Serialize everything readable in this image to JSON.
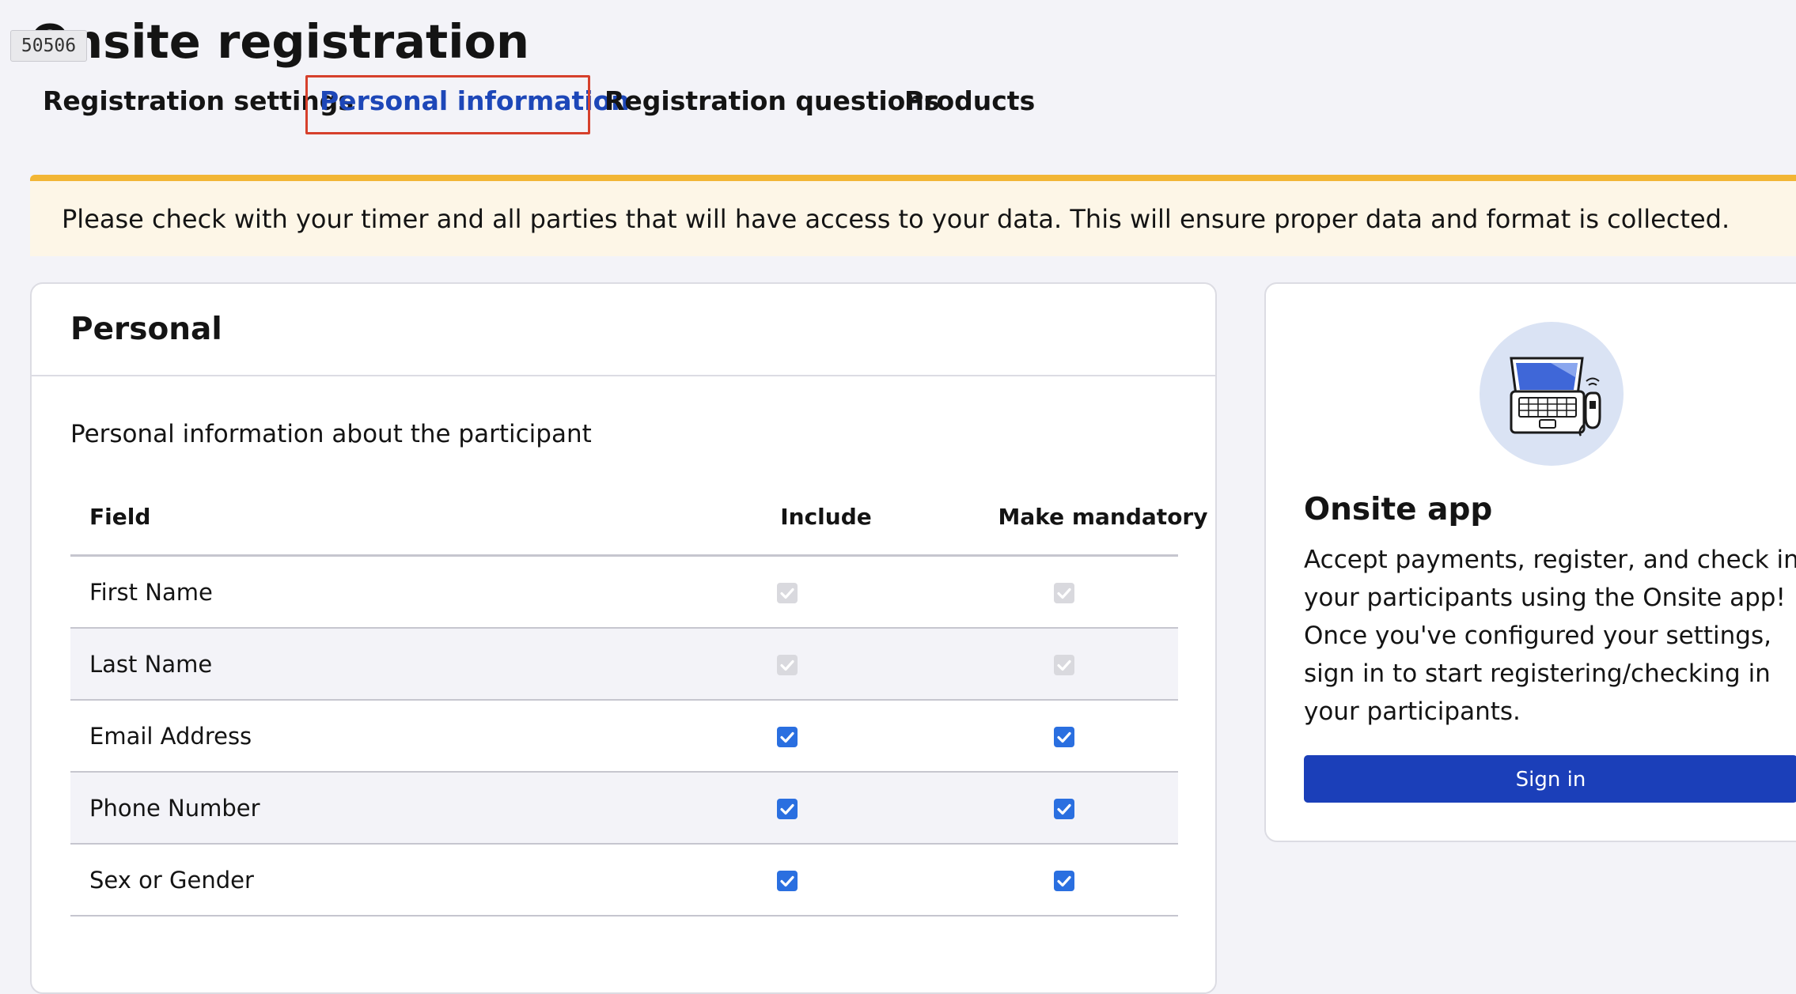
{
  "page": {
    "id_badge": "50506",
    "title": "Onsite registration"
  },
  "tabs": [
    {
      "label": "Registration settings"
    },
    {
      "label": "Personal information",
      "active": true
    },
    {
      "label": "Registration questions"
    },
    {
      "label": "Products"
    }
  ],
  "alert": {
    "text": "Please check with your timer and all parties that will have access to your data. This will ensure proper data and format is collected."
  },
  "personal_card": {
    "title": "Personal",
    "description": "Personal information about the participant",
    "columns": {
      "field": "Field",
      "include": "Include",
      "mandatory": "Make mandatory"
    },
    "rows": [
      {
        "field": "First Name",
        "include": true,
        "mandatory": true,
        "disabled": true
      },
      {
        "field": "Last Name",
        "include": true,
        "mandatory": true,
        "disabled": true
      },
      {
        "field": "Email Address",
        "include": true,
        "mandatory": true,
        "disabled": false
      },
      {
        "field": "Phone Number",
        "include": true,
        "mandatory": true,
        "disabled": false
      },
      {
        "field": "Sex or Gender",
        "include": true,
        "mandatory": true,
        "disabled": false
      }
    ]
  },
  "app_card": {
    "illustration": "laptop-card-reader-icon",
    "title": "Onsite app",
    "description": "Accept payments, register, and check in your participants using the Onsite app! Once you've configured your settings, sign in to start registering/checking in your participants.",
    "button_label": "Sign in"
  },
  "colors": {
    "accent": "#1d47b8",
    "button": "#1b3fb9",
    "checkbox": "#2a6fe0",
    "alert_border": "#f2b635",
    "alert_bg": "#fdf6e7",
    "focus_outline": "#d6402c"
  }
}
